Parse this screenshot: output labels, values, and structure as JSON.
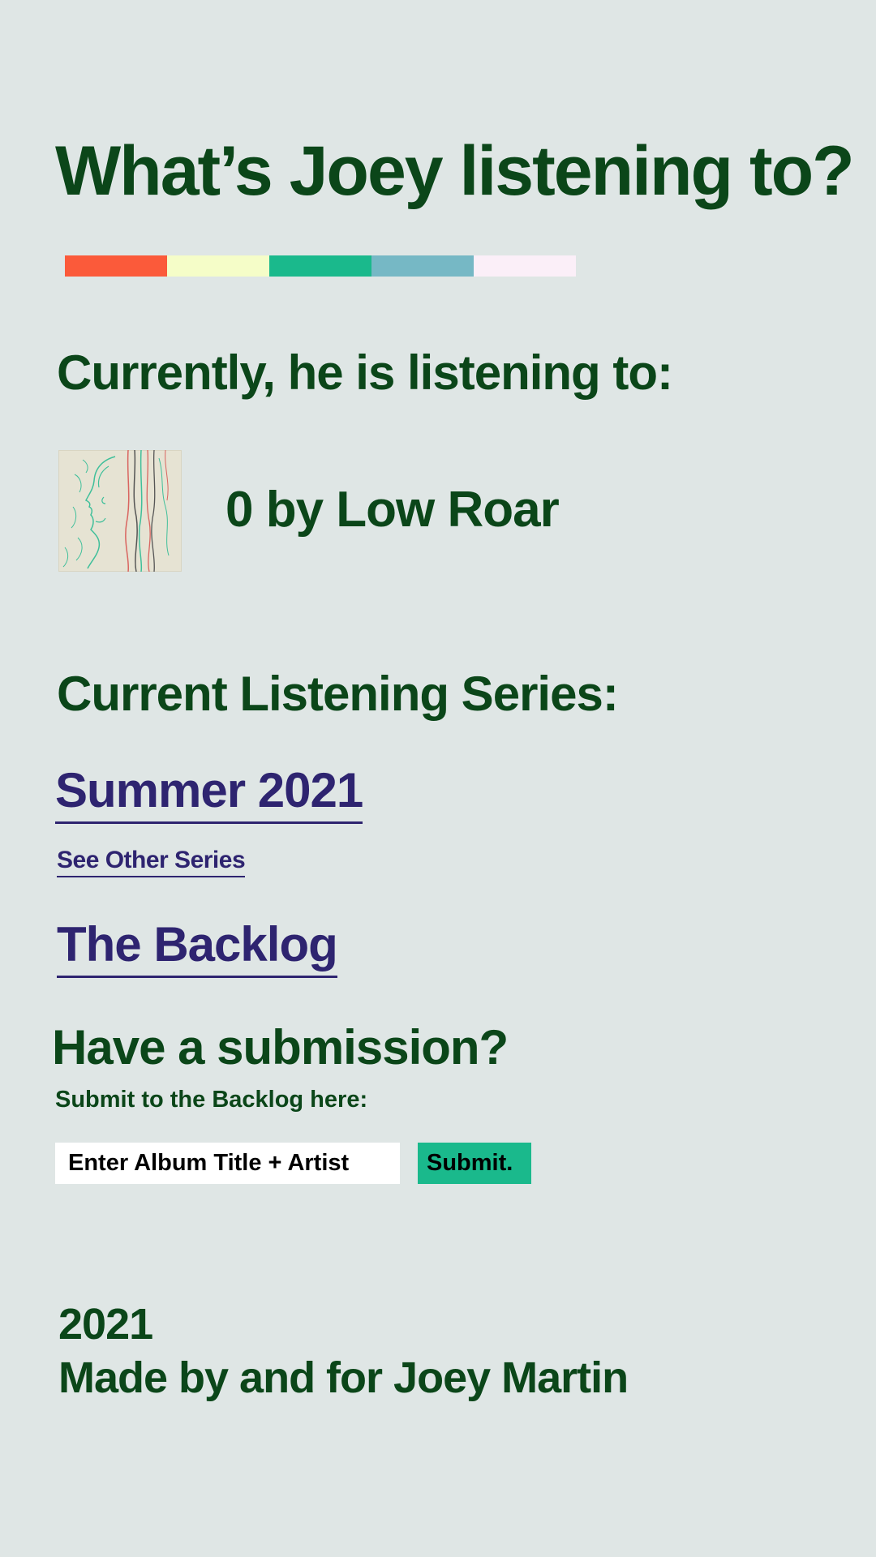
{
  "page": {
    "title": "What’s Joey listening to?"
  },
  "palette": {
    "colors": [
      "#fb5a3a",
      "#f5fdc8",
      "#1ab98c",
      "#76b8c5",
      "#fbeff8"
    ]
  },
  "now_playing": {
    "heading": "Currently, he is listening to:",
    "track_text": "0 by Low Roar",
    "album_art_icon": "album-cover-line-art"
  },
  "series": {
    "heading": "Current Listening Series:",
    "current_link": "Summer 2021",
    "other_link": "See Other Series",
    "backlog_link": "The Backlog"
  },
  "submission": {
    "heading": "Have a submission?",
    "label": "Submit to the Backlog here:",
    "input_placeholder": "Enter Album Title + Artist",
    "input_value": "",
    "submit_label": "Submit."
  },
  "footer": {
    "year": "2021",
    "credit": "Made by and for Joey Martin"
  },
  "colors": {
    "background": "#dfe6e5",
    "text": "#0b4619",
    "link": "#2e2470",
    "button": "#1ab98c"
  }
}
